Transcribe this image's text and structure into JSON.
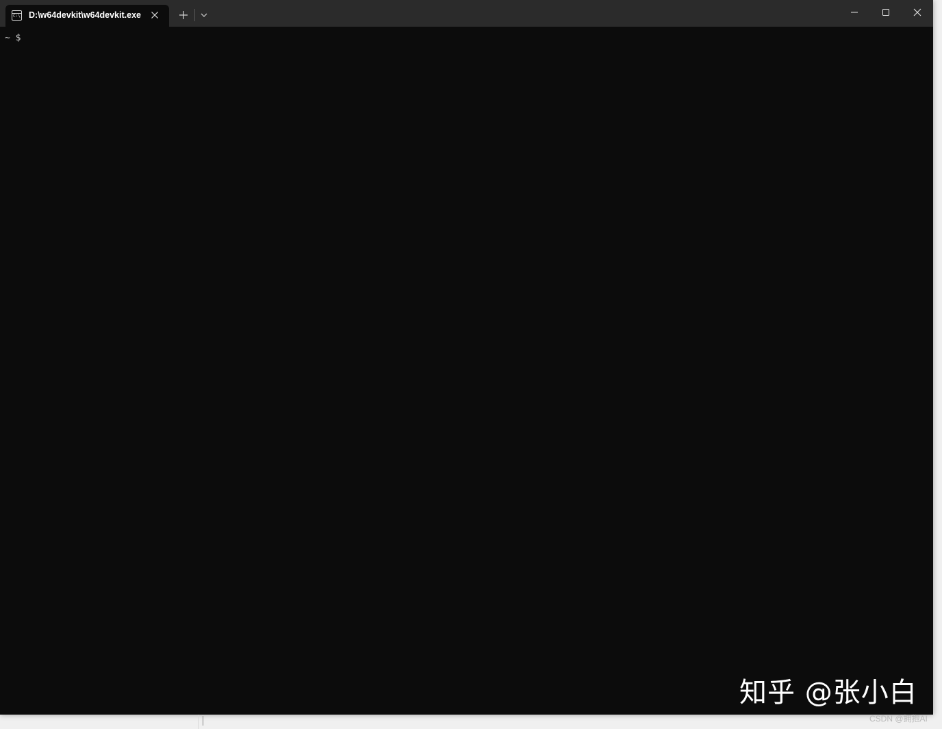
{
  "window": {
    "tab_title": "D:\\w64devkit\\w64devkit.exe",
    "tab_icon": "terminal-icon",
    "tab_icon_text": "C:\\",
    "new_tab_label": "+",
    "controls": [
      "minimize-icon",
      "maximize-icon",
      "close-icon"
    ]
  },
  "terminal": {
    "prompt": "~ $",
    "background": "#0c0c0c",
    "text_color": "#cccccc"
  },
  "overlay": {
    "watermark": "知乎 @张小白",
    "source_credit": "CSDN @拥抱AI"
  }
}
